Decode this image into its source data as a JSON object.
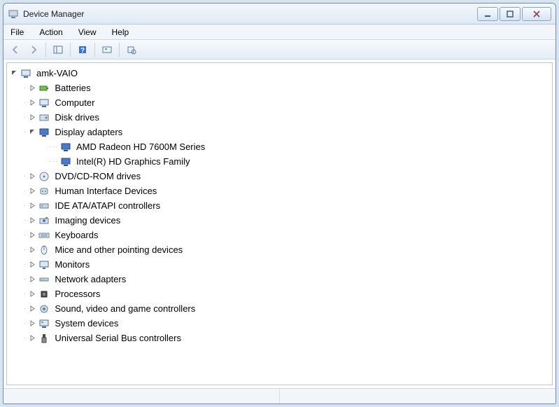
{
  "window": {
    "title": "Device Manager"
  },
  "menu": {
    "file": "File",
    "action": "Action",
    "view": "View",
    "help": "Help"
  },
  "tree": {
    "root": {
      "label": "amk-VAIO",
      "icon": "computer",
      "expanded": true
    },
    "categories": [
      {
        "label": "Batteries",
        "icon": "battery",
        "expanded": false,
        "children": []
      },
      {
        "label": "Computer",
        "icon": "computer",
        "expanded": false,
        "children": []
      },
      {
        "label": "Disk drives",
        "icon": "disk",
        "expanded": false,
        "children": []
      },
      {
        "label": "Display adapters",
        "icon": "display",
        "expanded": true,
        "children": [
          {
            "label": "AMD Radeon HD 7600M Series",
            "icon": "display"
          },
          {
            "label": "Intel(R) HD Graphics Family",
            "icon": "display"
          }
        ]
      },
      {
        "label": "DVD/CD-ROM drives",
        "icon": "optical",
        "expanded": false,
        "children": []
      },
      {
        "label": "Human Interface Devices",
        "icon": "hid",
        "expanded": false,
        "children": []
      },
      {
        "label": "IDE ATA/ATAPI controllers",
        "icon": "ide",
        "expanded": false,
        "children": []
      },
      {
        "label": "Imaging devices",
        "icon": "imaging",
        "expanded": false,
        "children": []
      },
      {
        "label": "Keyboards",
        "icon": "keyboard",
        "expanded": false,
        "children": []
      },
      {
        "label": "Mice and other pointing devices",
        "icon": "mouse",
        "expanded": false,
        "children": []
      },
      {
        "label": "Monitors",
        "icon": "monitor",
        "expanded": false,
        "children": []
      },
      {
        "label": "Network adapters",
        "icon": "network",
        "expanded": false,
        "children": []
      },
      {
        "label": "Processors",
        "icon": "cpu",
        "expanded": false,
        "children": []
      },
      {
        "label": "Sound, video and game controllers",
        "icon": "sound",
        "expanded": false,
        "children": []
      },
      {
        "label": "System devices",
        "icon": "system",
        "expanded": false,
        "children": []
      },
      {
        "label": "Universal Serial Bus controllers",
        "icon": "usb",
        "expanded": false,
        "children": []
      }
    ]
  }
}
